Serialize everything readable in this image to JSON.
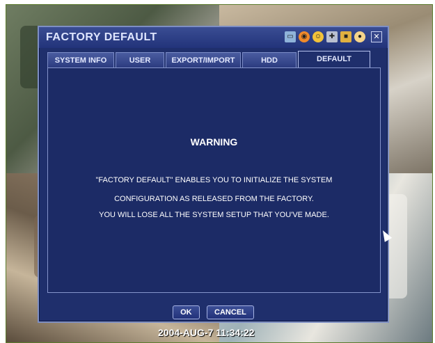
{
  "dialog": {
    "title": "FACTORY DEFAULT",
    "toolbar_icons": [
      "monitor-icon",
      "globe-icon",
      "smiley-icon",
      "tools-icon",
      "camera-icon",
      "user-icon"
    ],
    "close_symbol": "✕"
  },
  "tabs": [
    {
      "label": "SYSTEM INFO",
      "active": false
    },
    {
      "label": "USER",
      "active": false
    },
    {
      "label": "EXPORT/IMPORT",
      "active": false
    },
    {
      "label": "HDD",
      "active": false
    },
    {
      "label": "DEFAULT",
      "active": true
    }
  ],
  "content": {
    "warning_title": "WARNING",
    "lines": [
      "\"FACTORY DEFAULT\" ENABLES YOU TO INITIALIZE THE SYSTEM",
      "CONFIGURATION AS RELEASED FROM THE FACTORY.",
      "YOU WILL LOSE ALL THE SYSTEM SETUP THAT YOU'VE MADE."
    ]
  },
  "buttons": {
    "ok_label": "OK",
    "cancel_label": "CANCEL"
  },
  "timestamp": "2004-AUG-7 11:34:22",
  "colors": {
    "dialog_bg": "#1f2f6c",
    "titlebar": "#22337a",
    "border": "#7e8fc4"
  }
}
